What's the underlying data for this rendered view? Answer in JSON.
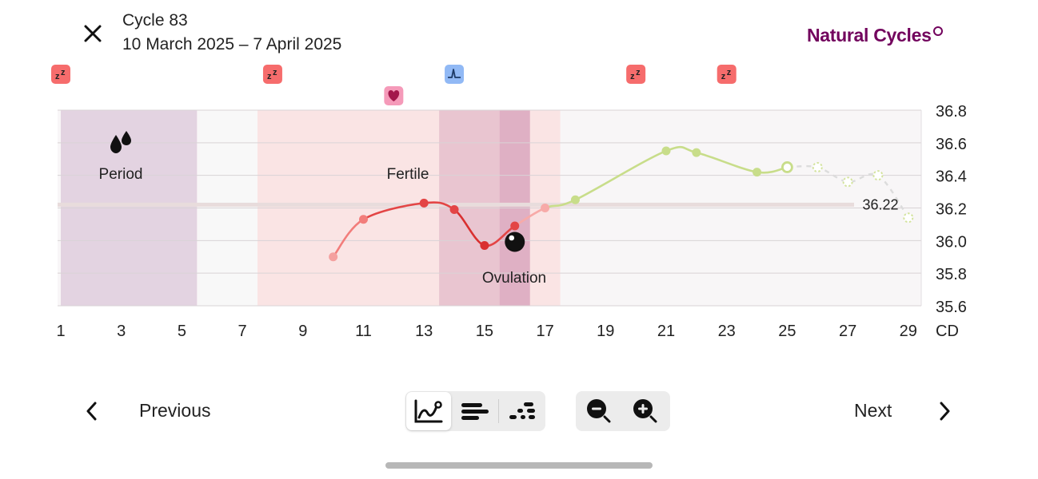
{
  "header": {
    "title": "Cycle 83",
    "date_range": "10 March 2025 – 7 April 2025",
    "brand": "Natural Cycles"
  },
  "chart_data": {
    "type": "line",
    "x_axis_label": "CD",
    "x_ticks": [
      "1",
      "3",
      "5",
      "7",
      "9",
      "11",
      "13",
      "15",
      "17",
      "19",
      "21",
      "23",
      "25",
      "27",
      "29"
    ],
    "y_ticks": [
      "36.8",
      "36.6",
      "36.4",
      "36.2",
      "36.0",
      "35.8",
      "35.6"
    ],
    "ylim": [
      35.6,
      36.8
    ],
    "xlim": [
      1,
      29
    ],
    "coverline_value": 36.22,
    "coverline_label": "36.22",
    "phases": [
      {
        "name": "period",
        "label": "Period",
        "from_day": 1,
        "to_day": 5.5,
        "color": "#e3d3e1"
      },
      {
        "name": "fertile",
        "label": "Fertile",
        "from_day": 7.5,
        "to_day": 17.5,
        "color": "#fae4e4"
      },
      {
        "name": "high-fertile",
        "label": "",
        "from_day": 13.5,
        "to_day": 16.5,
        "color": "#e9c5d0"
      },
      {
        "name": "ovulation",
        "label": "Ovulation",
        "from_day": 15.5,
        "to_day": 16.5,
        "color": "#dfb0c4"
      }
    ],
    "temperatures": [
      {
        "day": 10,
        "temp": 35.9,
        "color": "#f4a09f"
      },
      {
        "day": 11,
        "temp": 36.13,
        "color": "#f27d7b"
      },
      {
        "day": 13,
        "temp": 36.23,
        "color": "#e34545"
      },
      {
        "day": 14,
        "temp": 36.19,
        "color": "#e34545"
      },
      {
        "day": 15,
        "temp": 35.97,
        "color": "#d93030"
      },
      {
        "day": 16,
        "temp": 36.09,
        "color": "#e34545"
      },
      {
        "day": 17,
        "temp": 36.2,
        "color": "#f7aaa8"
      },
      {
        "day": 18,
        "temp": 36.25,
        "color": "#c8dd8a"
      },
      {
        "day": 21,
        "temp": 36.55,
        "color": "#c8dd8a"
      },
      {
        "day": 22,
        "temp": 36.54,
        "color": "#c8dd8a"
      },
      {
        "day": 24,
        "temp": 36.42,
        "color": "#c8dd8a"
      },
      {
        "day": 25,
        "temp": 36.45,
        "color": "#c8dd8a",
        "style": "hollow"
      }
    ],
    "predicted": [
      {
        "day": 26,
        "temp": 36.45
      },
      {
        "day": 27,
        "temp": 36.36
      },
      {
        "day": 28,
        "temp": 36.4
      },
      {
        "day": 29,
        "temp": 36.14
      }
    ],
    "markers": [
      {
        "day": 1,
        "icon": "sleep-icon",
        "color": "#f66c6c"
      },
      {
        "day": 8,
        "icon": "sleep-icon",
        "color": "#f66c6c"
      },
      {
        "day": 12,
        "icon": "heart-icon",
        "color": "#f59ab9"
      },
      {
        "day": 14,
        "icon": "lh-test-icon",
        "color": "#91b9f5"
      },
      {
        "day": 20,
        "icon": "sleep-icon",
        "color": "#f66c6c"
      },
      {
        "day": 23,
        "icon": "sleep-icon",
        "color": "#f66c6c"
      }
    ],
    "ovulation_day": 16,
    "period_icon": "drops-icon"
  },
  "footer": {
    "previous_label": "Previous",
    "next_label": "Next",
    "view_modes": [
      {
        "name": "graph-view",
        "active": true
      },
      {
        "name": "list-view",
        "active": false
      },
      {
        "name": "dots-view",
        "active": false
      }
    ],
    "zoom": [
      "zoom-out",
      "zoom-in"
    ]
  }
}
